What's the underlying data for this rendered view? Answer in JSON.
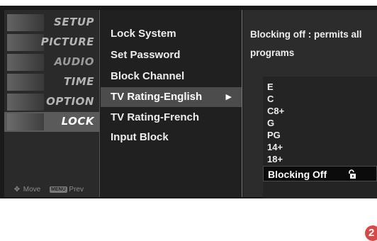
{
  "sidebar": {
    "categories": [
      {
        "label": "SETUP"
      },
      {
        "label": "PICTURE"
      },
      {
        "label": "AUDIO"
      },
      {
        "label": "TIME"
      },
      {
        "label": "OPTION"
      },
      {
        "label": "LOCK"
      }
    ],
    "active_category": "LOCK",
    "hint": {
      "move_icon": "move-joystick-icon",
      "move_label": "Move",
      "prev_key": "MENU",
      "prev_label": "Prev"
    }
  },
  "submenu": {
    "items": [
      {
        "label": "Lock System"
      },
      {
        "label": "Set Password"
      },
      {
        "label": "Block Channel"
      },
      {
        "label": "TV Rating-English",
        "arrow": "▶"
      },
      {
        "label": "TV Rating-French"
      },
      {
        "label": "Input Block"
      }
    ],
    "selected": "TV Rating-English"
  },
  "detail": {
    "description_line1": "Blocking off : permits all",
    "description_line2": "programs",
    "ratings": [
      "E",
      "C",
      "C8+",
      "G",
      "PG",
      "14+",
      "18+",
      "Blocking Off"
    ],
    "selected_rating": "Blocking Off",
    "selected_icon": "unlock-icon"
  },
  "page_badge": "2",
  "colors": {
    "screen_bg": "#1a1a1a",
    "selection_bg": "#4c4c4c",
    "text": "#ededed",
    "badge": "#d24a4a"
  }
}
